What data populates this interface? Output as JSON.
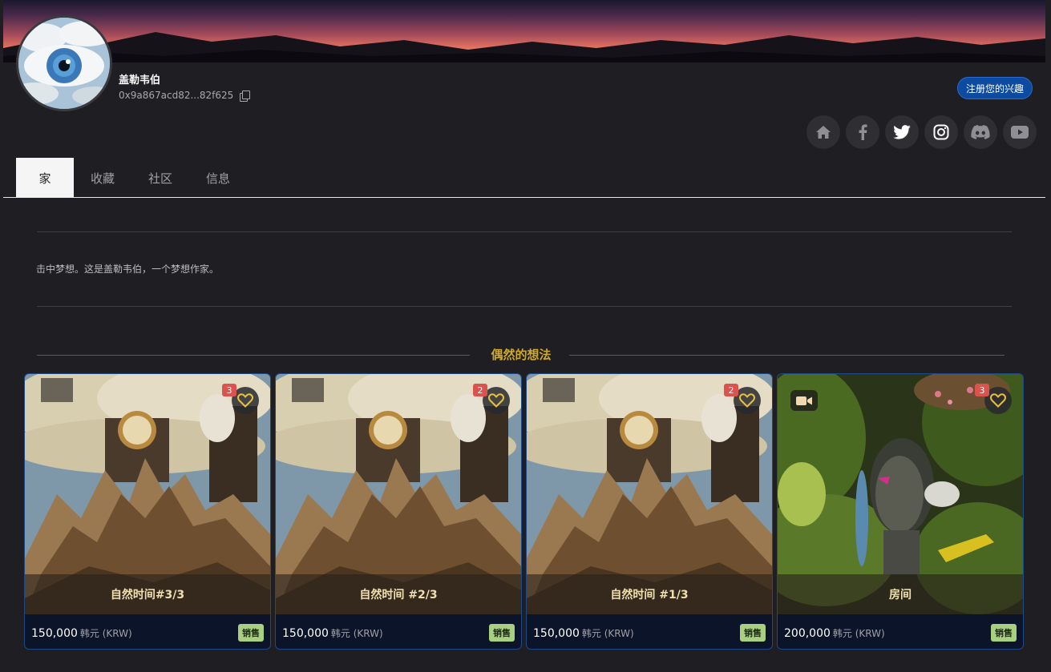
{
  "profile": {
    "name": "盖勒韦伯",
    "address": "0x9a867acd82...82f625",
    "interest_button": "注册您的兴趣"
  },
  "socials": [
    {
      "name": "home-icon"
    },
    {
      "name": "facebook-icon"
    },
    {
      "name": "twitter-icon"
    },
    {
      "name": "instagram-icon"
    },
    {
      "name": "discord-icon"
    },
    {
      "name": "youtube-icon"
    }
  ],
  "tabs": [
    {
      "label": "家",
      "active": true
    },
    {
      "label": "收藏",
      "active": false
    },
    {
      "label": "社区",
      "active": false
    },
    {
      "label": "信息",
      "active": false
    }
  ],
  "bio": "击中梦想。这是盖勒韦伯，一个梦想作家。",
  "section": {
    "title": "偶然的想法"
  },
  "cards": [
    {
      "title": "自然时间#3/3",
      "badge": "3",
      "price": "150,000",
      "currency": "韩元 (KRW)",
      "action": "销售",
      "video": false
    },
    {
      "title": "自然时间 #2/3",
      "badge": "2",
      "price": "150,000",
      "currency": "韩元 (KRW)",
      "action": "销售",
      "video": false
    },
    {
      "title": "自然时间 #1/3",
      "badge": "2",
      "price": "150,000",
      "currency": "韩元 (KRW)",
      "action": "销售",
      "video": false
    },
    {
      "title": "房间",
      "badge": "3",
      "price": "200,000",
      "currency": "韩元 (KRW)",
      "action": "销售",
      "video": true
    }
  ],
  "colors": {
    "background": "#1e1e23",
    "accent_gold": "#d0a82a",
    "card_border": "#1e4a88",
    "interest_button": "#0c4ba0",
    "sale_button": "#a8d080",
    "badge": "#d9534f"
  }
}
